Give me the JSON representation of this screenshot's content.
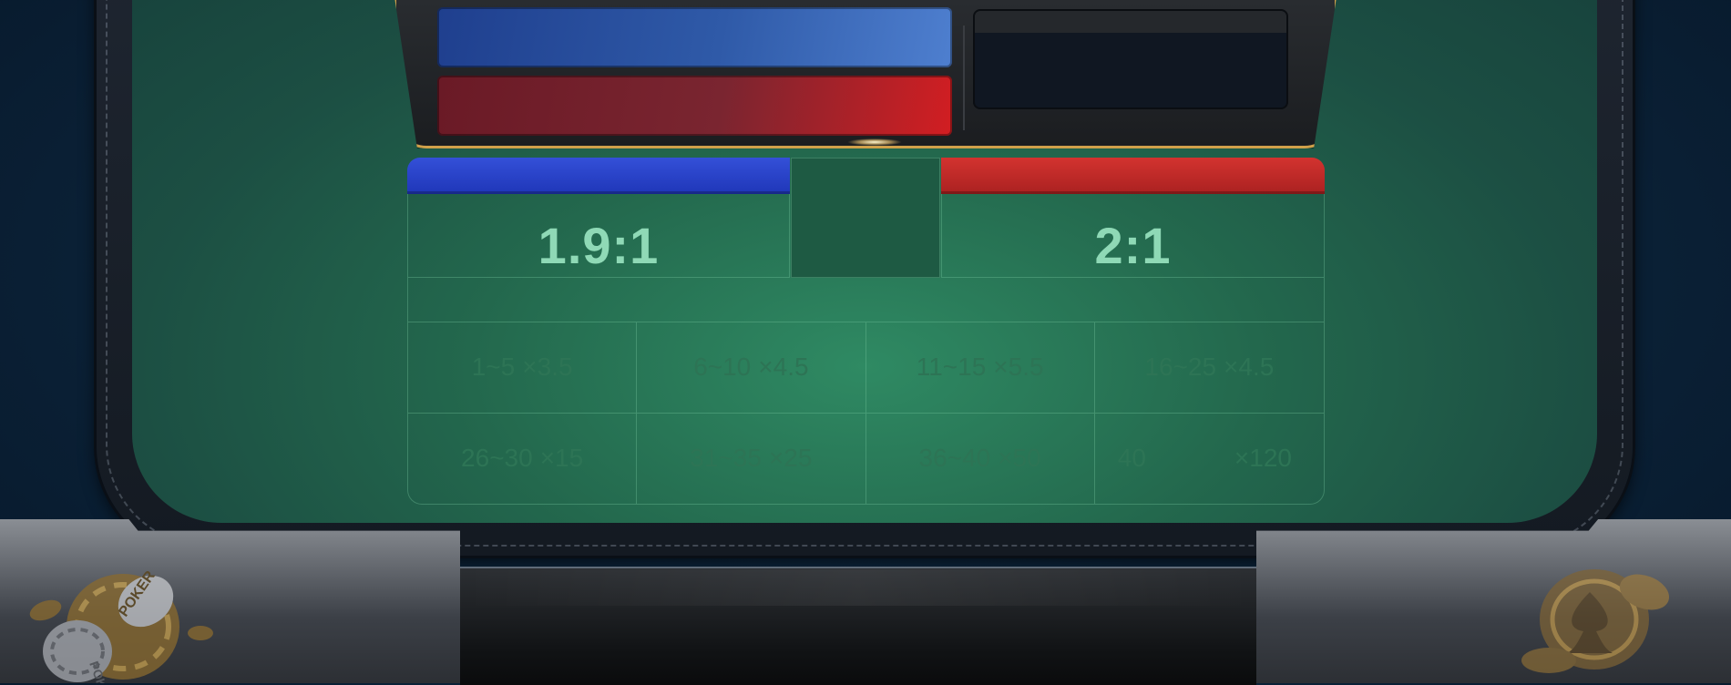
{
  "colors": {
    "felt": "#2f8a63",
    "banker_blue": "#2a44c8",
    "player_red": "#c42a28",
    "gold_trim": "#d0a04a"
  },
  "odds": {
    "left": "1.9:1",
    "right": "2:1"
  },
  "payouts": [
    {
      "range": "1~5",
      "multiplier": "×3.5"
    },
    {
      "range": "6~10",
      "multiplier": "×4.5"
    },
    {
      "range": "11~15",
      "multiplier": "×5.5"
    },
    {
      "range": "16~25",
      "multiplier": "×4.5"
    },
    {
      "range": "26~30",
      "multiplier": "×15"
    },
    {
      "range": "31~35",
      "multiplier": "×25"
    },
    {
      "range": "36~40",
      "multiplier": "×50"
    },
    {
      "range": "40",
      "multiplier": "×120"
    }
  ],
  "decor": {
    "left_chip_text": "POKER",
    "icons": [
      "poker-chips-icon",
      "spade-trophy-icon"
    ]
  }
}
